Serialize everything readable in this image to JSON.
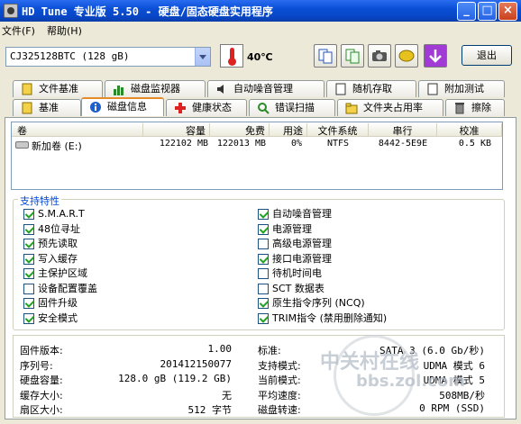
{
  "window": {
    "title": "HD Tune 专业版 5.50 - 硬盘/固态硬盘实用程序"
  },
  "menu": {
    "file": "文件(F)",
    "help": "帮助(H)"
  },
  "toolbar": {
    "drive": "CJ325128BTC (128 gB)",
    "temperature": "40℃",
    "exit": "退出"
  },
  "tabs_row1": [
    "文件基准",
    "磁盘监视器",
    "自动噪音管理",
    "随机存取",
    "附加测试"
  ],
  "tabs_row2": [
    "基准",
    "磁盘信息",
    "健康状态",
    "错误扫描",
    "文件夹占用率",
    "擦除"
  ],
  "active_tab": "磁盘信息",
  "volume_table": {
    "headers": [
      "卷",
      "容量",
      "免费",
      "用途",
      "文件系统",
      "串行",
      "校准"
    ],
    "rows": [
      {
        "name": "新加卷 (E:)",
        "capacity": "122102 MB",
        "free": "122013 MB",
        "usage": "0%",
        "fs": "NTFS",
        "serial": "8442-5E9E",
        "align": "0.5 KB"
      }
    ]
  },
  "features_label": "支持特性",
  "features_left": [
    {
      "label": "S.M.A.R.T",
      "checked": true
    },
    {
      "label": "48位寻址",
      "checked": true
    },
    {
      "label": "预先读取",
      "checked": true
    },
    {
      "label": "写入缓存",
      "checked": true
    },
    {
      "label": "主保护区域",
      "checked": true
    },
    {
      "label": "设备配置覆盖",
      "checked": false
    },
    {
      "label": "固件升级",
      "checked": true
    },
    {
      "label": "安全模式",
      "checked": true
    }
  ],
  "features_right": [
    {
      "label": "自动噪音管理",
      "checked": true
    },
    {
      "label": "电源管理",
      "checked": true
    },
    {
      "label": "高级电源管理",
      "checked": false
    },
    {
      "label": "接口电源管理",
      "checked": true
    },
    {
      "label": "待机时间电",
      "checked": false
    },
    {
      "label": "SCT 数据表",
      "checked": false
    },
    {
      "label": "原生指令序列 (NCQ)",
      "checked": true
    },
    {
      "label": "TRIM指令 (禁用删除通知)",
      "checked": true
    }
  ],
  "info_left": [
    {
      "label": "固件版本:",
      "value": "1.00"
    },
    {
      "label": "序列号:",
      "value": "201412150077"
    },
    {
      "label": "硬盘容量:",
      "value": "128.0 gB (119.2 GB)"
    },
    {
      "label": "缓存大小:",
      "value": "无"
    },
    {
      "label": "扇区大小:",
      "value": "512 字节"
    }
  ],
  "info_right": [
    {
      "label": "标准:",
      "value": "SATA 3 (6.0 Gb/秒)"
    },
    {
      "label": "支持模式:",
      "value": "UDMA 模式 6"
    },
    {
      "label": "当前模式:",
      "value": "UDMA 模式 5"
    },
    {
      "label": "平均速度:",
      "value": "508MB/秒"
    },
    {
      "label": "磁盘转速:",
      "value": "0 RPM (SSD)"
    }
  ],
  "watermark": {
    "line1": "中关村在线",
    "line2": "bbs.zol.com"
  }
}
